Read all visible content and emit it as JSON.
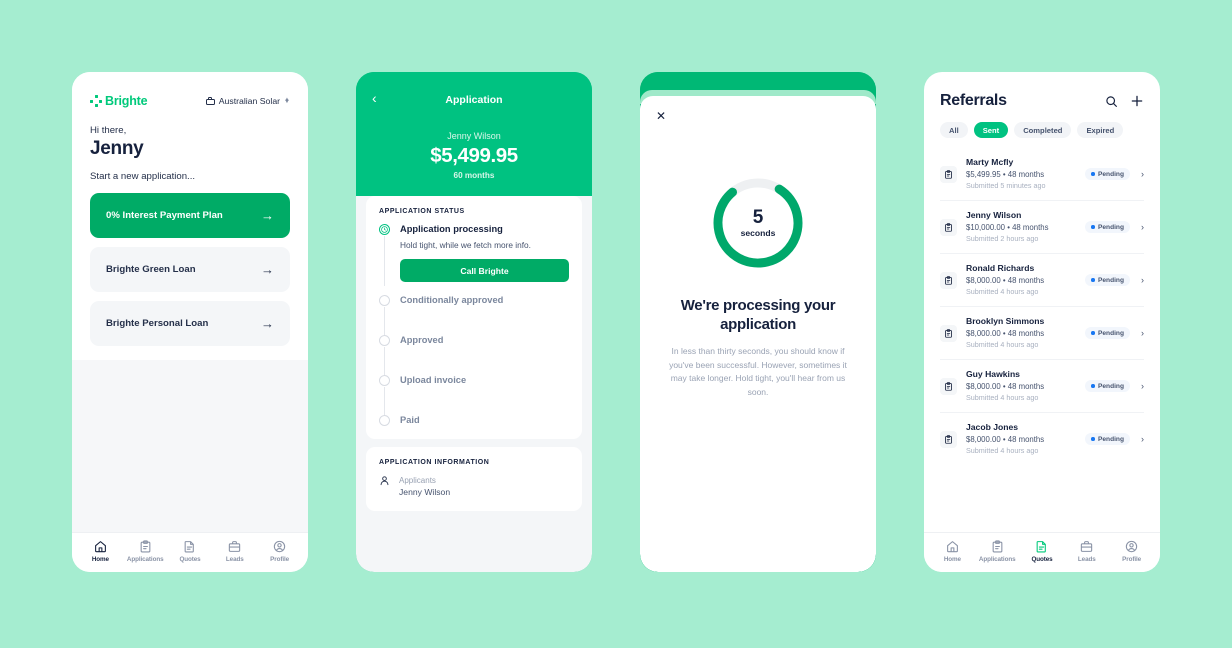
{
  "background_color": "#a5edd0",
  "brand": {
    "name": "Brighte",
    "green": "#00c97b",
    "primary_green": "#00ab66",
    "hero_green": "#00c281"
  },
  "phone1": {
    "logo_text": "Brighte",
    "org_selector": {
      "label": "Australian Solar",
      "icon": "briefcase-icon",
      "chevron": "up-down-chevron-icon"
    },
    "greeting": "Hi there,",
    "user_name": "Jenny",
    "start_label": "Start a new application...",
    "loan_options": [
      {
        "label": "0% Interest Payment Plan",
        "style": "primary"
      },
      {
        "label": "Brighte Green Loan",
        "style": "muted"
      },
      {
        "label": "Brighte Personal Loan",
        "style": "muted"
      }
    ],
    "tabs": [
      {
        "label": "Home",
        "icon": "home-icon",
        "active": true
      },
      {
        "label": "Applications",
        "icon": "clipboard-icon",
        "active": false
      },
      {
        "label": "Quotes",
        "icon": "document-icon",
        "active": false
      },
      {
        "label": "Leads",
        "icon": "briefcase-icon",
        "active": false
      },
      {
        "label": "Profile",
        "icon": "profile-icon",
        "active": false
      }
    ]
  },
  "phone2": {
    "back_icon": "chevron-left-icon",
    "title": "Application",
    "customer": "Jenny Wilson",
    "amount": "$5,499.95",
    "term": "60 months",
    "status_card_title": "APPLICATION STATUS",
    "steps": [
      {
        "label": "Application processing",
        "sub": "Hold tight, while we fetch more info.",
        "state": "current"
      },
      {
        "label": "Conditionally approved",
        "state": "todo"
      },
      {
        "label": "Approved",
        "state": "todo"
      },
      {
        "label": "Upload invoice",
        "state": "todo"
      },
      {
        "label": "Paid",
        "state": "todo"
      }
    ],
    "call_button": "Call Brighte",
    "info_card_title": "APPLICATION INFORMATION",
    "applicants_label": "Applicants",
    "applicants_value": "Jenny Wilson"
  },
  "phone3": {
    "close_icon": "close-icon",
    "countdown_number": "5",
    "countdown_unit": "seconds",
    "progress_percent": 80,
    "title": "We're processing your application",
    "body": "In less than thirty seconds, you should know if you've been successful. However, sometimes it may take longer. Hold tight, you'll hear from us soon."
  },
  "phone4": {
    "title": "Referrals",
    "search_icon": "search-icon",
    "add_icon": "plus-icon",
    "filters": [
      {
        "label": "All",
        "active": false
      },
      {
        "label": "Sent",
        "active": true
      },
      {
        "label": "Completed",
        "active": false
      },
      {
        "label": "Expired",
        "active": false
      }
    ],
    "referrals": [
      {
        "name": "Marty Mcfly",
        "amount": "$5,499.95 • 48 months",
        "submitted": "Submitted 5 minutes ago",
        "status": "Pending"
      },
      {
        "name": "Jenny Wilson",
        "amount": "$10,000.00 • 48 months",
        "submitted": "Submitted 2 hours ago",
        "status": "Pending"
      },
      {
        "name": "Ronald Richards",
        "amount": "$8,000.00 • 48 months",
        "submitted": "Submitted 4 hours ago",
        "status": "Pending"
      },
      {
        "name": "Brooklyn Simmons",
        "amount": "$8,000.00 • 48 months",
        "submitted": "Submitted 4 hours ago",
        "status": "Pending"
      },
      {
        "name": "Guy Hawkins",
        "amount": "$8,000.00 • 48 months",
        "submitted": "Submitted 4 hours ago",
        "status": "Pending"
      },
      {
        "name": "Jacob Jones",
        "amount": "$8,000.00 • 48 months",
        "submitted": "Submitted 4 hours ago",
        "status": "Pending"
      }
    ],
    "tabs": [
      {
        "label": "Home",
        "icon": "home-icon",
        "active": false
      },
      {
        "label": "Applications",
        "icon": "clipboard-icon",
        "active": false
      },
      {
        "label": "Quotes",
        "icon": "document-icon",
        "active": true
      },
      {
        "label": "Leads",
        "icon": "briefcase-icon",
        "active": false
      },
      {
        "label": "Profile",
        "icon": "profile-icon",
        "active": false
      }
    ]
  }
}
